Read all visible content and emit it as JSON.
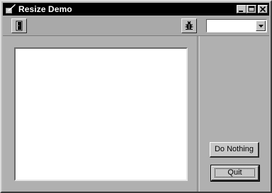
{
  "window": {
    "title": "Resize Demo",
    "title_icon": "app-pen-icon",
    "controls": [
      "minimize-icon",
      "maximize-icon",
      "close-icon"
    ]
  },
  "toolbar": {
    "left_button_icon": "door-icon",
    "right_button_icon": "bug-icon",
    "combo": {
      "value": "",
      "arrow_icon": "chevron-down-icon"
    }
  },
  "buttons": {
    "do_nothing": "Do Nothing",
    "quit": "Quit"
  },
  "colors": {
    "titlebar": "#000000",
    "face": "#b5b5b5",
    "content_background": "#ffffff"
  }
}
